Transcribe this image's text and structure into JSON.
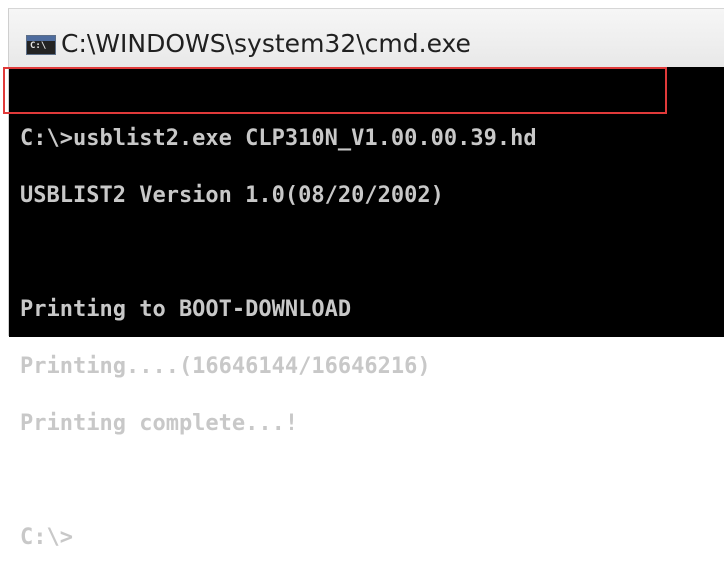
{
  "window": {
    "title": "C:\\WINDOWS\\system32\\cmd.exe",
    "icon": "cmd-icon",
    "icon_glyph": "C:\\"
  },
  "console": {
    "lines": [
      "C:\\>usblist2.exe CLP310N_V1.00.00.39.hd",
      "USBLIST2 Version 1.0(08/20/2002)",
      "",
      "Printing to BOOT-DOWNLOAD",
      "Printing....(16646144/16646216)",
      "Printing complete...!",
      "",
      "C:\\>"
    ]
  },
  "annotation": {
    "highlight_color": "#e03a3a"
  }
}
